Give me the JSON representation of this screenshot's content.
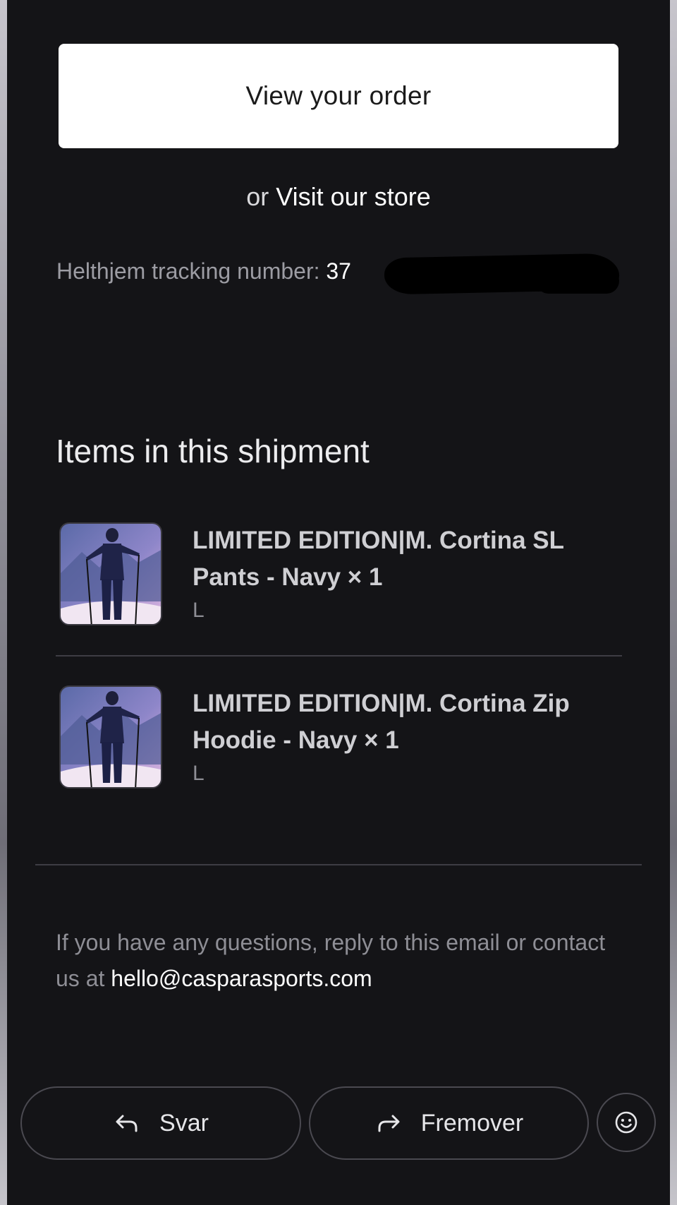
{
  "email": {
    "order_button": "View your order",
    "visit_prefix": "or",
    "visit_link": "Visit our store",
    "tracking_label": "Helthjem tracking number:",
    "tracking_number_visible": "37",
    "shipment_title": "Items in this shipment",
    "items": [
      {
        "title": "LIMITED EDITION|M. Cortina SL Pants - Navy × 1",
        "variant": "L"
      },
      {
        "title": "LIMITED EDITION|M. Cortina Zip Hoodie - Navy × 1",
        "variant": "L"
      }
    ],
    "contact_text": "If you have any questions, reply to this email or contact us at",
    "contact_email": "hello@casparasports.com"
  },
  "actions": {
    "reply_label": "Svar",
    "forward_label": "Fremover",
    "reply_icon": "reply-icon",
    "forward_icon": "forward-icon",
    "emoji_icon": "emoji-icon"
  },
  "colors": {
    "panel_bg": "#141417",
    "button_bg": "#ffffff",
    "muted_text": "#8e8e95"
  }
}
